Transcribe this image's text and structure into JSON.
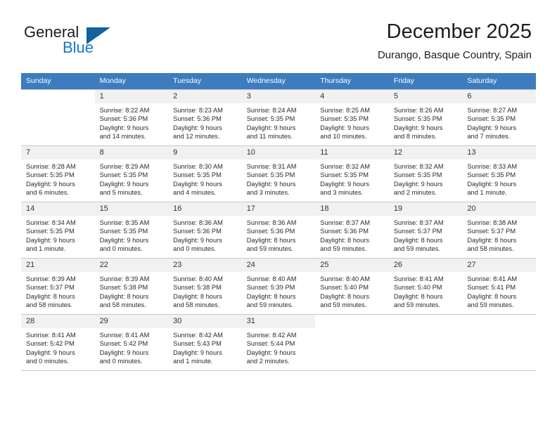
{
  "brand": {
    "name_part1": "General",
    "name_part2": "Blue",
    "accent_color": "#1477c8",
    "triangle_color": "#14619e"
  },
  "header": {
    "title": "December 2025",
    "subtitle": "Durango, Basque Country, Spain"
  },
  "calendar": {
    "header_bg": "#3c7cbf",
    "daynum_bg": "#f1f1f1",
    "weekday_headers": [
      "Sunday",
      "Monday",
      "Tuesday",
      "Wednesday",
      "Thursday",
      "Friday",
      "Saturday"
    ],
    "weeks": [
      [
        {
          "day": "",
          "lines": []
        },
        {
          "day": "1",
          "lines": [
            "Sunrise: 8:22 AM",
            "Sunset: 5:36 PM",
            "Daylight: 9 hours",
            "and 14 minutes."
          ]
        },
        {
          "day": "2",
          "lines": [
            "Sunrise: 8:23 AM",
            "Sunset: 5:36 PM",
            "Daylight: 9 hours",
            "and 12 minutes."
          ]
        },
        {
          "day": "3",
          "lines": [
            "Sunrise: 8:24 AM",
            "Sunset: 5:35 PM",
            "Daylight: 9 hours",
            "and 11 minutes."
          ]
        },
        {
          "day": "4",
          "lines": [
            "Sunrise: 8:25 AM",
            "Sunset: 5:35 PM",
            "Daylight: 9 hours",
            "and 10 minutes."
          ]
        },
        {
          "day": "5",
          "lines": [
            "Sunrise: 8:26 AM",
            "Sunset: 5:35 PM",
            "Daylight: 9 hours",
            "and 8 minutes."
          ]
        },
        {
          "day": "6",
          "lines": [
            "Sunrise: 8:27 AM",
            "Sunset: 5:35 PM",
            "Daylight: 9 hours",
            "and 7 minutes."
          ]
        }
      ],
      [
        {
          "day": "7",
          "lines": [
            "Sunrise: 8:28 AM",
            "Sunset: 5:35 PM",
            "Daylight: 9 hours",
            "and 6 minutes."
          ]
        },
        {
          "day": "8",
          "lines": [
            "Sunrise: 8:29 AM",
            "Sunset: 5:35 PM",
            "Daylight: 9 hours",
            "and 5 minutes."
          ]
        },
        {
          "day": "9",
          "lines": [
            "Sunrise: 8:30 AM",
            "Sunset: 5:35 PM",
            "Daylight: 9 hours",
            "and 4 minutes."
          ]
        },
        {
          "day": "10",
          "lines": [
            "Sunrise: 8:31 AM",
            "Sunset: 5:35 PM",
            "Daylight: 9 hours",
            "and 3 minutes."
          ]
        },
        {
          "day": "11",
          "lines": [
            "Sunrise: 8:32 AM",
            "Sunset: 5:35 PM",
            "Daylight: 9 hours",
            "and 3 minutes."
          ]
        },
        {
          "day": "12",
          "lines": [
            "Sunrise: 8:32 AM",
            "Sunset: 5:35 PM",
            "Daylight: 9 hours",
            "and 2 minutes."
          ]
        },
        {
          "day": "13",
          "lines": [
            "Sunrise: 8:33 AM",
            "Sunset: 5:35 PM",
            "Daylight: 9 hours",
            "and 1 minute."
          ]
        }
      ],
      [
        {
          "day": "14",
          "lines": [
            "Sunrise: 8:34 AM",
            "Sunset: 5:35 PM",
            "Daylight: 9 hours",
            "and 1 minute."
          ]
        },
        {
          "day": "15",
          "lines": [
            "Sunrise: 8:35 AM",
            "Sunset: 5:35 PM",
            "Daylight: 9 hours",
            "and 0 minutes."
          ]
        },
        {
          "day": "16",
          "lines": [
            "Sunrise: 8:36 AM",
            "Sunset: 5:36 PM",
            "Daylight: 9 hours",
            "and 0 minutes."
          ]
        },
        {
          "day": "17",
          "lines": [
            "Sunrise: 8:36 AM",
            "Sunset: 5:36 PM",
            "Daylight: 8 hours",
            "and 59 minutes."
          ]
        },
        {
          "day": "18",
          "lines": [
            "Sunrise: 8:37 AM",
            "Sunset: 5:36 PM",
            "Daylight: 8 hours",
            "and 59 minutes."
          ]
        },
        {
          "day": "19",
          "lines": [
            "Sunrise: 8:37 AM",
            "Sunset: 5:37 PM",
            "Daylight: 8 hours",
            "and 59 minutes."
          ]
        },
        {
          "day": "20",
          "lines": [
            "Sunrise: 8:38 AM",
            "Sunset: 5:37 PM",
            "Daylight: 8 hours",
            "and 58 minutes."
          ]
        }
      ],
      [
        {
          "day": "21",
          "lines": [
            "Sunrise: 8:39 AM",
            "Sunset: 5:37 PM",
            "Daylight: 8 hours",
            "and 58 minutes."
          ]
        },
        {
          "day": "22",
          "lines": [
            "Sunrise: 8:39 AM",
            "Sunset: 5:38 PM",
            "Daylight: 8 hours",
            "and 58 minutes."
          ]
        },
        {
          "day": "23",
          "lines": [
            "Sunrise: 8:40 AM",
            "Sunset: 5:38 PM",
            "Daylight: 8 hours",
            "and 58 minutes."
          ]
        },
        {
          "day": "24",
          "lines": [
            "Sunrise: 8:40 AM",
            "Sunset: 5:39 PM",
            "Daylight: 8 hours",
            "and 59 minutes."
          ]
        },
        {
          "day": "25",
          "lines": [
            "Sunrise: 8:40 AM",
            "Sunset: 5:40 PM",
            "Daylight: 8 hours",
            "and 59 minutes."
          ]
        },
        {
          "day": "26",
          "lines": [
            "Sunrise: 8:41 AM",
            "Sunset: 5:40 PM",
            "Daylight: 8 hours",
            "and 59 minutes."
          ]
        },
        {
          "day": "27",
          "lines": [
            "Sunrise: 8:41 AM",
            "Sunset: 5:41 PM",
            "Daylight: 8 hours",
            "and 59 minutes."
          ]
        }
      ],
      [
        {
          "day": "28",
          "lines": [
            "Sunrise: 8:41 AM",
            "Sunset: 5:42 PM",
            "Daylight: 9 hours",
            "and 0 minutes."
          ]
        },
        {
          "day": "29",
          "lines": [
            "Sunrise: 8:41 AM",
            "Sunset: 5:42 PM",
            "Daylight: 9 hours",
            "and 0 minutes."
          ]
        },
        {
          "day": "30",
          "lines": [
            "Sunrise: 8:42 AM",
            "Sunset: 5:43 PM",
            "Daylight: 9 hours",
            "and 1 minute."
          ]
        },
        {
          "day": "31",
          "lines": [
            "Sunrise: 8:42 AM",
            "Sunset: 5:44 PM",
            "Daylight: 9 hours",
            "and 2 minutes."
          ]
        },
        {
          "day": "",
          "lines": []
        },
        {
          "day": "",
          "lines": []
        },
        {
          "day": "",
          "lines": []
        }
      ]
    ]
  }
}
